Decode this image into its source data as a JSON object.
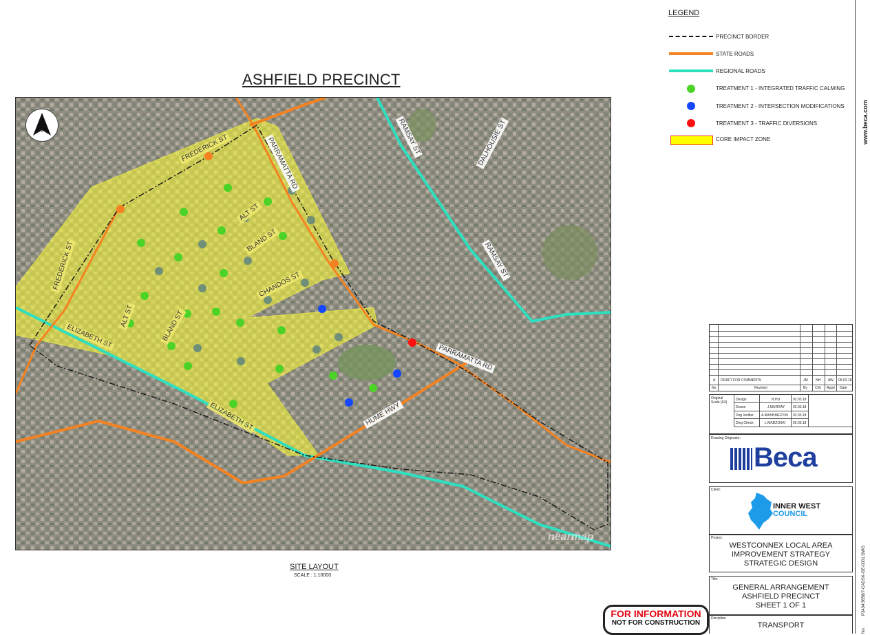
{
  "title": "ASHFIELD PRECINCT",
  "map": {
    "north_label": "N",
    "watermark": "nearmap",
    "roads": {
      "frederick_st_a": "FREDERICK ST",
      "frederick_st_b": "FREDERICK ST",
      "parramatta_rd_a": "PARRAMATTA RD",
      "parramatta_rd_b": "PARRAMATTA RD",
      "ramsay_st_a": "RAMSAY ST",
      "ramsay_st_b": "RAMSAY ST",
      "dalhousie_st": "DALHOUSIE ST",
      "alt_st_a": "ALT ST",
      "alt_st_b": "ALT ST",
      "bland_st_a": "BLAND ST",
      "bland_st_b": "BLAND ST",
      "chandos_st": "CHANDOS ST",
      "elizabeth_st_a": "ELIZABETH ST",
      "elizabeth_st_b": "ELIZABETH ST",
      "hume_hwy": "HUME HWY"
    },
    "colors": {
      "state_roads": "#f58220",
      "regional_roads": "#2de0c0",
      "treatment_1": "#4cd327",
      "treatment_2": "#1447ff",
      "treatment_3": "#ff1010",
      "core_zone": "#ffff33",
      "border": "#222222"
    }
  },
  "site_layout": {
    "label": "SITE LAYOUT",
    "scale": "SCALE : 1:10000"
  },
  "legend": {
    "title": "LEGEND",
    "items": [
      {
        "label": "PRECINCT BORDER",
        "symbol": "dash-dot-line"
      },
      {
        "label": "STATE ROADS",
        "symbol": "orange-line"
      },
      {
        "label": "REGIONAL ROADS",
        "symbol": "teal-line"
      },
      {
        "label": "TREATMENT 1 - INTEGRATED TRAFFIC CALMING",
        "symbol": "green-dot"
      },
      {
        "label": "TREATMENT 2 - INTERSECTION MODIFICATIONS",
        "symbol": "blue-dot"
      },
      {
        "label": "TREATMENT 3 - TRAFFIC DIVERSIONS",
        "symbol": "red-dot"
      },
      {
        "label": "CORE IMPACT ZONE",
        "symbol": "yellow-box"
      }
    ]
  },
  "sidebar": {
    "website": "www.beca.com",
    "drawing_no": "P3434‘3658/7-CADSK-GE-0001.DWG",
    "no_label": "No."
  },
  "revision": {
    "row": {
      "rev": "A",
      "desc": "DRAFT FOR COMMENTS",
      "by": "JM",
      "chk": "NH",
      "appd": "AW",
      "date": "05.02.18"
    },
    "headers": {
      "no": "No.",
      "revision": "Revision",
      "by": "By",
      "chk": "Chk",
      "appd": "Appd",
      "date": "Date"
    }
  },
  "signoff": {
    "scale_label": "Original Scale (A3)",
    "rows": [
      {
        "role": "Design",
        "name": "N.HU",
        "date": "02.03.18"
      },
      {
        "role": "Drawn",
        "name": "J.MURRAY",
        "date": "02.03.18"
      },
      {
        "role": "Dsg Verifier",
        "name": "A.WASHINGTON",
        "date": "02.03.18"
      },
      {
        "role": "Dwg Check",
        "name": "L.MADZOSKI",
        "date": "02.03.18"
      }
    ]
  },
  "originator": {
    "label": "Drawing Originator:",
    "logo_text": "Beca"
  },
  "client": {
    "label": "Client:",
    "name_line1": "INNER WEST",
    "name_line2": "COUNCIL"
  },
  "project": {
    "label": "Project:",
    "line1": "WESTCONNEX LOCAL AREA",
    "line2": "IMPROVEMENT STRATEGY",
    "line3": "STRATEGIC DESIGN"
  },
  "drawing_title": {
    "label": "Title:",
    "line1": "GENERAL ARRANGEMENT",
    "line2": "ASHFIELD PRECINCT",
    "line3": "SHEET 1 OF 1"
  },
  "discipline": {
    "label": "Discipline",
    "value": "TRANSPORT"
  },
  "stamp": {
    "line1": "FOR INFORMATION",
    "line2": "NOT FOR CONSTRUCTION"
  }
}
